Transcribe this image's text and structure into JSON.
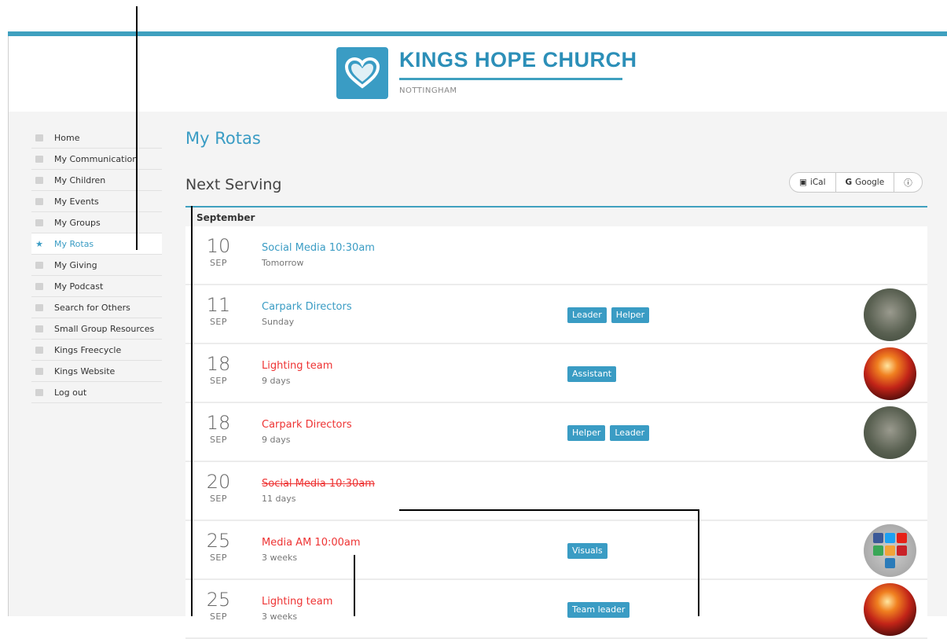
{
  "brand": {
    "name": "KINGS HOPE CHURCH",
    "location": "NOTTINGHAM",
    "logo_icon": "heart-icon",
    "accent": "#3a9cc4"
  },
  "sidebar": {
    "items": [
      {
        "label": "Home",
        "icon": "home-icon"
      },
      {
        "label": "My Communication",
        "icon": "chat-icon"
      },
      {
        "label": "My Children",
        "icon": "child-icon"
      },
      {
        "label": "My Events",
        "icon": "calendar-icon"
      },
      {
        "label": "My Groups",
        "icon": "group-icon"
      },
      {
        "label": "My Rotas",
        "icon": "star-icon",
        "active": true
      },
      {
        "label": "My Giving",
        "icon": "money-icon"
      },
      {
        "label": "My Podcast",
        "icon": "headphones-icon"
      },
      {
        "label": "Search for Others",
        "icon": "search-icon"
      },
      {
        "label": "Small Group Resources",
        "icon": "link-icon"
      },
      {
        "label": "Kings Freecycle",
        "icon": "link-icon"
      },
      {
        "label": "Kings Website",
        "icon": "link-icon"
      },
      {
        "label": "Log out",
        "icon": "logout-icon"
      }
    ]
  },
  "main": {
    "page_title": "My Rotas",
    "section_title": "Next Serving",
    "export_buttons": [
      {
        "label": "iCal",
        "icon": "calendar-icon"
      },
      {
        "label": "Google",
        "icon": "google-icon"
      },
      {
        "label": "",
        "icon": "info-icon"
      }
    ],
    "month": "September",
    "rows": [
      {
        "day": "10",
        "month": "SEP",
        "title": "Social Media 10:30am",
        "subtitle": "Tomorrow",
        "color": "blue",
        "struck": false,
        "roles": [],
        "avatar": ""
      },
      {
        "day": "11",
        "month": "SEP",
        "title": "Carpark Directors",
        "subtitle": "Sunday",
        "color": "blue",
        "struck": false,
        "roles": [
          "Leader",
          "Helper"
        ],
        "avatar": "person"
      },
      {
        "day": "18",
        "month": "SEP",
        "title": "Lighting team",
        "subtitle": "9 days",
        "color": "red",
        "struck": false,
        "roles": [
          "Assistant"
        ],
        "avatar": "light"
      },
      {
        "day": "18",
        "month": "SEP",
        "title": "Carpark Directors",
        "subtitle": "9 days",
        "color": "red",
        "struck": false,
        "roles": [
          "Helper",
          "Leader"
        ],
        "avatar": "person"
      },
      {
        "day": "20",
        "month": "SEP",
        "title": "Social Media 10:30am",
        "subtitle": "11 days",
        "color": "red",
        "struck": true,
        "roles": [],
        "avatar": ""
      },
      {
        "day": "25",
        "month": "SEP",
        "title": "Media AM 10:00am",
        "subtitle": "3 weeks",
        "color": "red",
        "struck": false,
        "roles": [
          "Visuals"
        ],
        "avatar": "social"
      },
      {
        "day": "25",
        "month": "SEP",
        "title": "Lighting team",
        "subtitle": "3 weeks",
        "color": "red",
        "struck": false,
        "roles": [
          "Team leader"
        ],
        "avatar": "light"
      }
    ]
  }
}
